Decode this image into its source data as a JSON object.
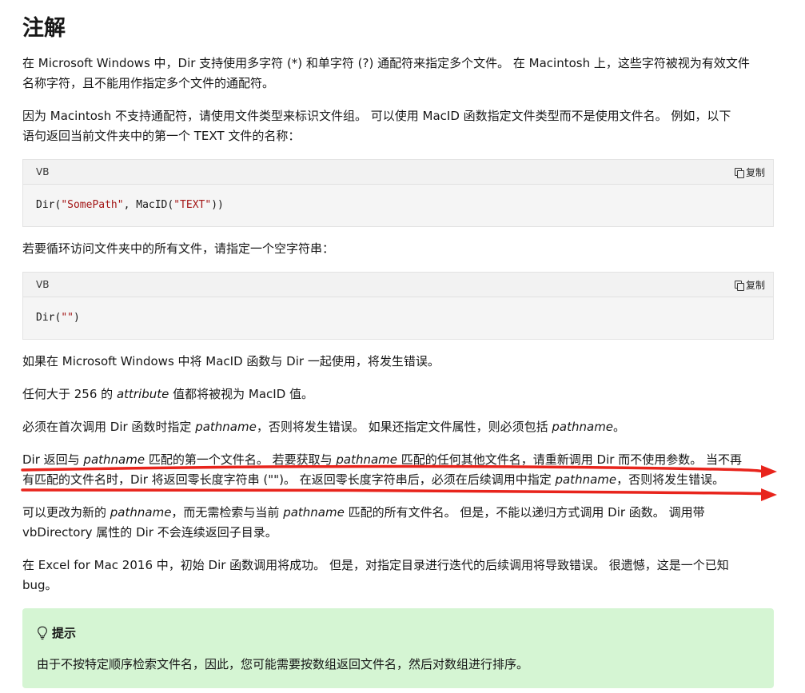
{
  "heading": "注解",
  "paragraphs": {
    "p1_line1": "在 Microsoft Windows 中，Dir 支持使用多字符 (*) 和单字符 (?) 通配符来指定多个文件。 在 Macintosh 上，这些字符被视为有效文件",
    "p1_line2": "名称字符，且不能用作指定多个文件的通配符。",
    "p2_line1": "因为 Macintosh 不支持通配符，请使用文件类型来标识文件组。 可以使用 MacID 函数指定文件类型而不是使用文件名。 例如，以下",
    "p2_line2": "语句返回当前文件夹中的第一个 TEXT 文件的名称：",
    "p3": "若要循环访问文件夹中的所有文件，请指定一个空字符串：",
    "p4": "如果在 Microsoft Windows 中将 MacID 函数与 Dir 一起使用，将发生错误。",
    "p5_a": "任何大于 256 的 ",
    "p5_b": "attribute",
    "p5_c": " 值都将被视为 MacID 值。",
    "p6_a": "必须在首次调用 Dir 函数时指定 ",
    "p6_b": "pathname",
    "p6_c": "，否则将发生错误。 如果还指定文件属性，则必须包括 ",
    "p6_d": "pathname",
    "p6_e": "。",
    "p7_l1_a": "Dir 返回与 ",
    "p7_l1_b": "pathname",
    "p7_l1_c": " 匹配的第一个文件名。 若要获取与 ",
    "p7_l1_d": "pathname",
    "p7_l1_e": " 匹配的任何其他文件名，请重新调用 Dir 而不使用参数。 当不再",
    "p7_l2_a": "有匹配的文件名时，Dir 将返回零长度字符串 (\"\")。 在返回零长度字符串后，必须在后续调用中指定 ",
    "p7_l2_b": "pathname",
    "p7_l2_c": "，否则将发生错误。",
    "p8_l1_a": "可以更改为新的 ",
    "p8_l1_b": "pathname",
    "p8_l1_c": "，而无需检索与当前 ",
    "p8_l1_d": "pathname",
    "p8_l1_e": " 匹配的所有文件名。 但是，不能以递归方式调用 Dir 函数。 调用带",
    "p8_l2": "vbDirectory 属性的 Dir 不会连续返回子目录。",
    "p9_line1": "在 Excel for Mac 2016 中，初始 Dir 函数调用将成功。 但是，对指定目录进行迭代的后续调用将导致错误。 很遗憾，这是一个已知",
    "p9_line2": "bug。"
  },
  "code_blocks": [
    {
      "lang": "VB",
      "copy_label": "复制",
      "code_a": "Dir(",
      "code_str1": "\"SomePath\"",
      "code_b": ", MacID(",
      "code_str2": "\"TEXT\"",
      "code_c": "))"
    },
    {
      "lang": "VB",
      "copy_label": "复制",
      "code_a": "Dir(",
      "code_str1": "\"\"",
      "code_c": ")"
    }
  ],
  "tip": {
    "title": "提示",
    "text": "由于不按特定顺序检索文件名，因此，您可能需要按数组返回文件名，然后对数组进行排序。"
  },
  "colors": {
    "tip_background": "#d5f5d3",
    "annotation_red": "#e8241c",
    "string_literal": "#a31515"
  }
}
